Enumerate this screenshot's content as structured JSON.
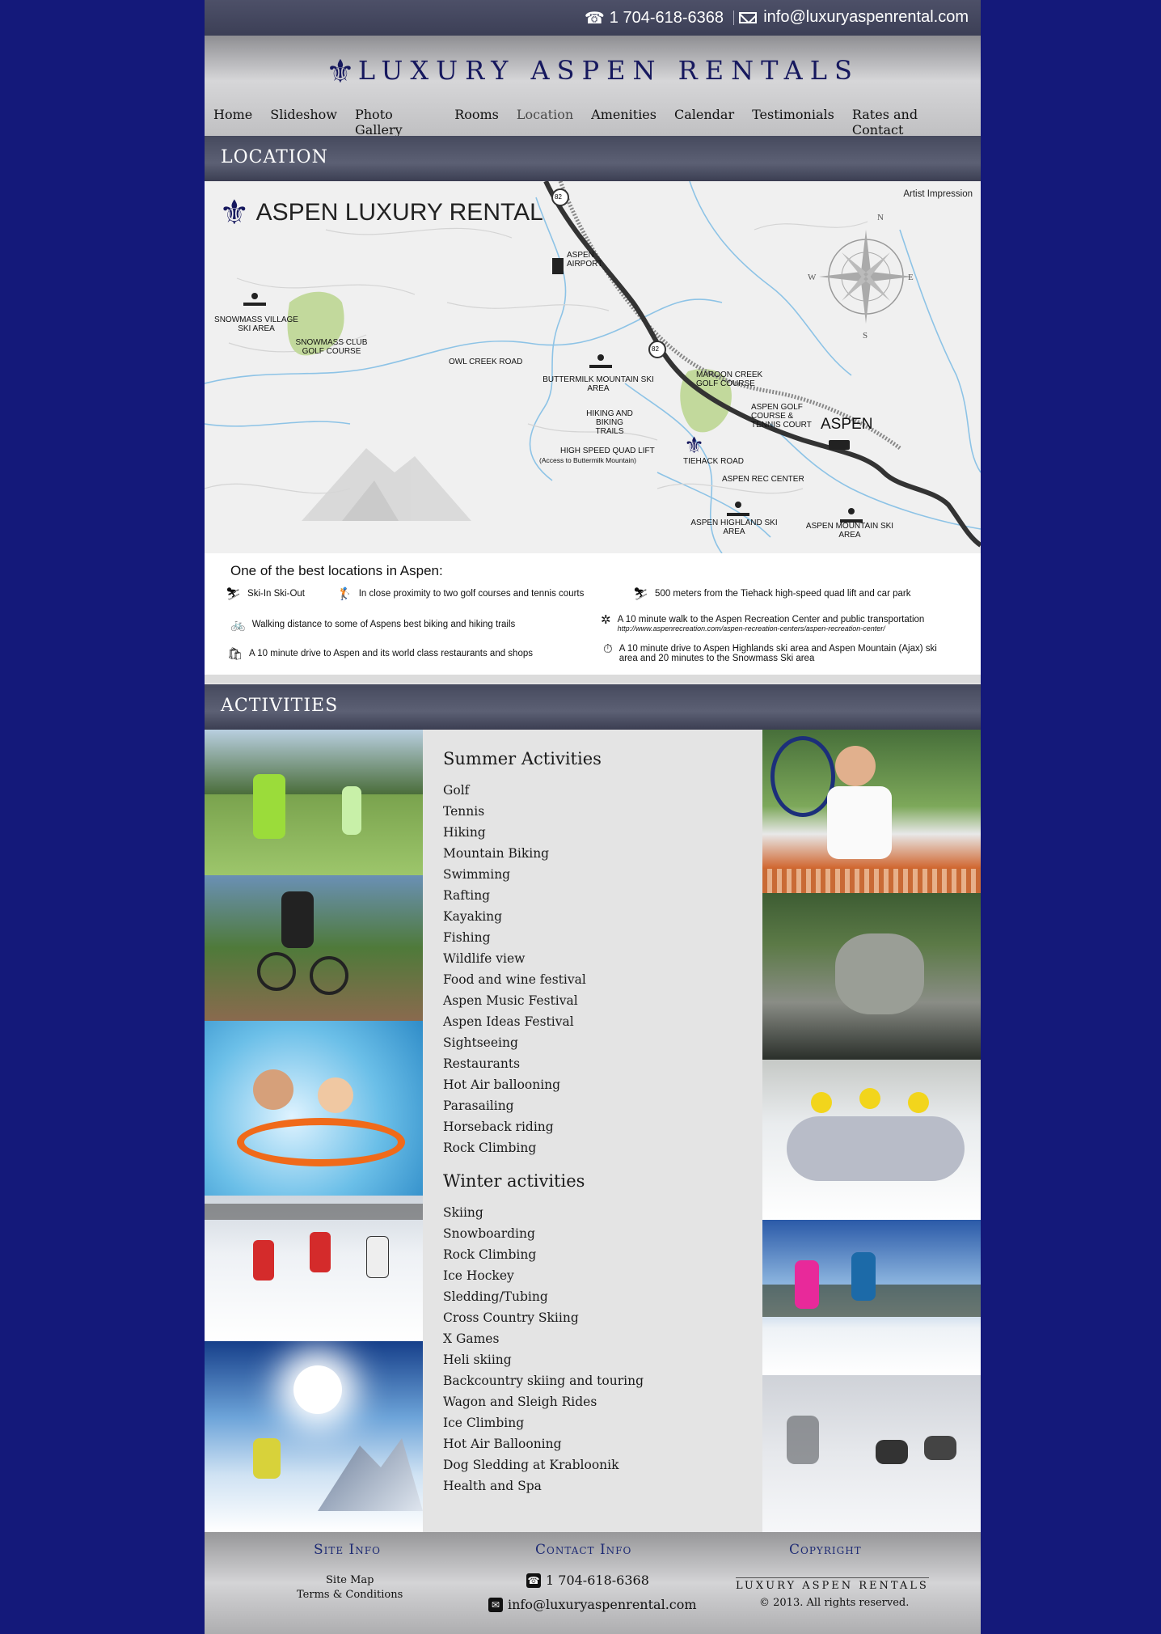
{
  "topbar": {
    "phone_icon": "☎",
    "phone": "1 704-618-6368",
    "email": "info@luxuryaspenrental.com"
  },
  "header": {
    "logo_text": "LUXURY ASPEN RENTALS"
  },
  "nav": [
    "Home",
    "Slideshow",
    "Photo Gallery",
    "Rooms",
    "Location",
    "Amenities",
    "Calendar",
    "Testimonials",
    "Rates and Contact"
  ],
  "location": {
    "title": "LOCATION",
    "map": {
      "brand": "ASPEN LUXURY RENTAL",
      "note": "Artist Impression",
      "compass": [
        "N",
        "E",
        "S",
        "W"
      ],
      "highway": "82",
      "labels": {
        "airport": "ASPEN AIRPORT",
        "snowmass_ski": "SNOWMASS VILLAGE SKI AREA",
        "snowmass_golf": "SNOWMASS CLUB GOLF COURSE",
        "owl": "OWL CREEK ROAD",
        "buttermilk": "BUTTERMILK MOUNTAIN SKI AREA",
        "hiking": "HIKING AND BIKING TRAILS",
        "quad": "HIGH SPEED QUAD LIFT",
        "quad_sub": "(Access to Buttermilk Mountain)",
        "maroon": "MAROON CREEK GOLF COURSE",
        "aspen_golf": "ASPEN GOLF COURSE & TENNIS COURT",
        "aspen": "ASPEN",
        "tiehack": "TIEHACK ROAD",
        "rec": "ASPEN REC CENTER",
        "highland": "ASPEN HIGHLAND SKI AREA",
        "mountain": "ASPEN MOUNTAIN SKI AREA"
      }
    },
    "legend": {
      "title": "One of the best locations in Aspen:",
      "items": [
        "Ski-In Ski-Out",
        "In close proximity to two golf courses and tennis courts",
        "500 meters from the Tiehack high-speed quad lift and car park",
        "Walking distance to some of Aspens best biking and hiking trails",
        "A 10 minute walk to the Aspen Recreation Center and public transportation",
        "A 10 minute drive to Aspen and its world class restaurants and shops",
        "A 10 minute drive to Aspen Highlands ski area and Aspen Mountain (Ajax) ski area and 20 minutes to the Snowmass Ski area"
      ],
      "rec_url": "http://www.aspenrecreation.com/aspen-recreation-centers/aspen-recreation-center/"
    }
  },
  "activities": {
    "title": "ACTIVITIES",
    "summer_title": "Summer Activities",
    "summer": [
      "Golf",
      "Tennis",
      "Hiking",
      "Mountain Biking",
      "Swimming",
      "Rafting",
      "Kayaking",
      "Fishing",
      "Wildlife view",
      "Food and wine festival",
      "Aspen Music Festival",
      "Aspen Ideas Festival",
      "Sightseeing",
      "Restaurants",
      "Hot Air ballooning",
      "Parasailing",
      "Horseback riding",
      "Rock Climbing"
    ],
    "winter_title": "Winter activities",
    "winter": [
      "Skiing",
      "Snowboarding",
      "Rock Climbing",
      "Ice Hockey",
      "Sledding/Tubing",
      "Cross Country Skiing",
      "X Games",
      "Heli skiing",
      "Backcountry skiing and touring",
      "Wagon and Sleigh Rides",
      "Ice Climbing",
      "Hot Air Ballooning",
      "Dog Sledding at Krabloonik",
      "Health and Spa"
    ]
  },
  "footer": {
    "site_info": "Site Info",
    "site_map": "Site Map",
    "terms": "Terms & Conditions",
    "contact_info": "Contact Info",
    "phone": "1 704-618-6368",
    "email": "info@luxuryaspenrental.com",
    "copyright": "Copyright",
    "copy_logo": "LUXURY ASPEN RENTALS",
    "copy_text": "© 2013. All rights reserved."
  }
}
